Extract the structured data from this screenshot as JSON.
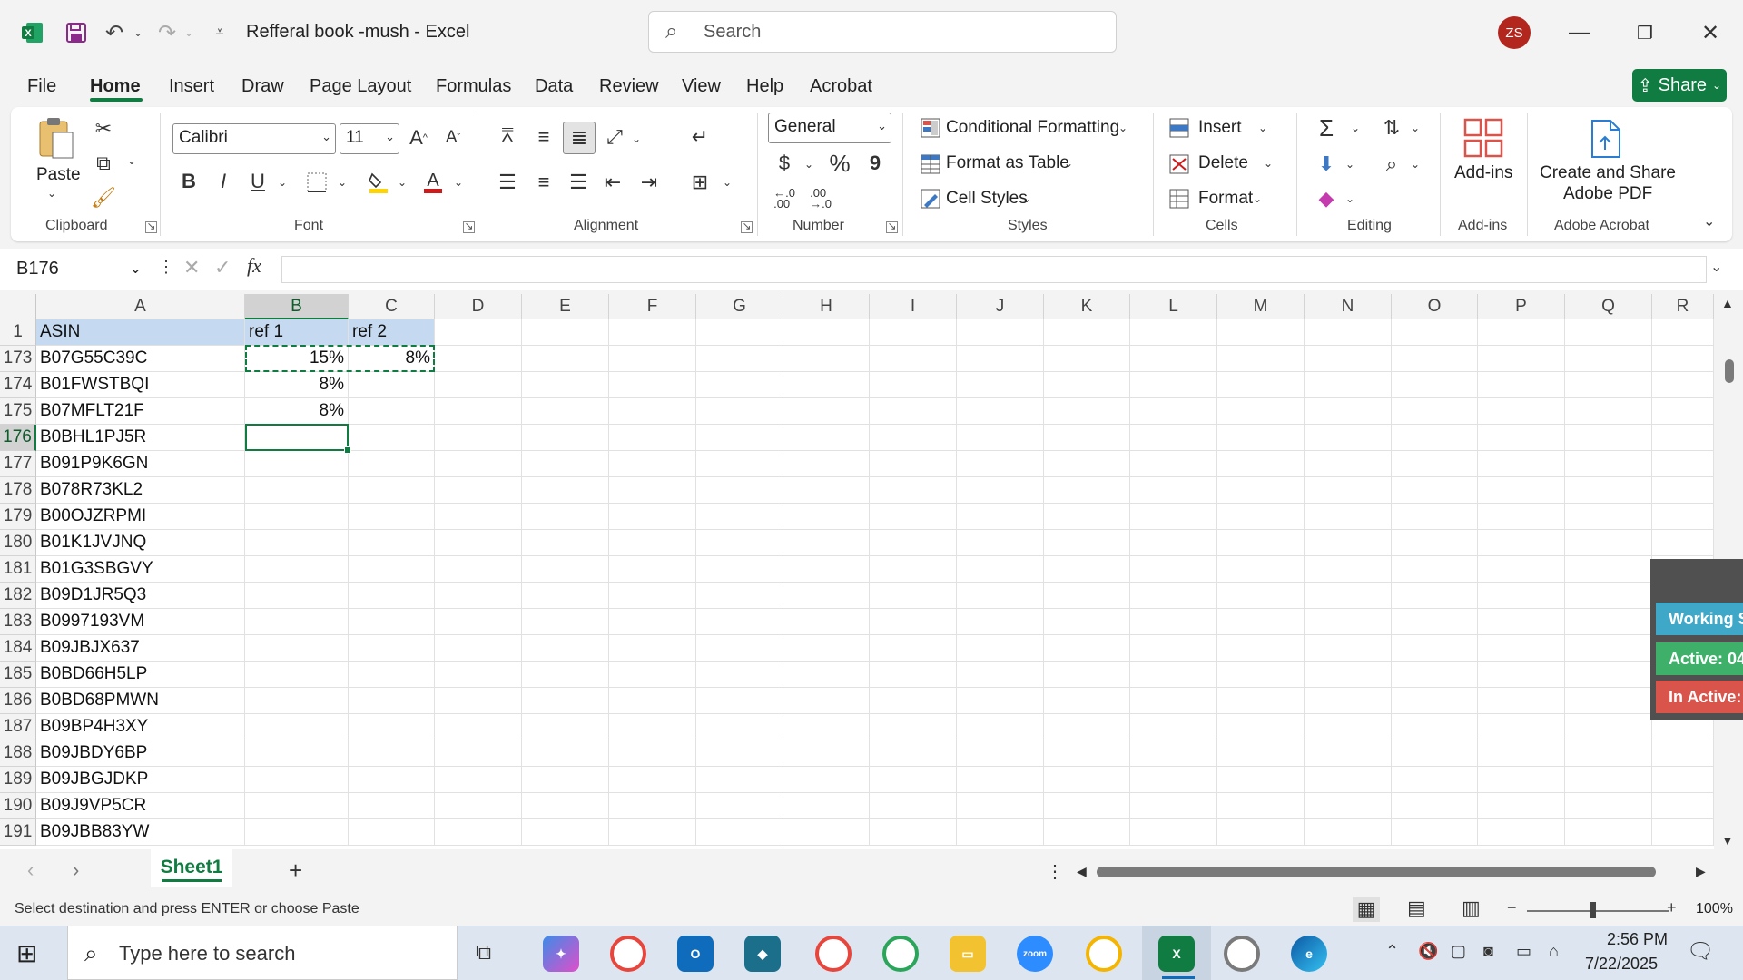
{
  "window": {
    "title": "Refferal book -mush  -  Excel",
    "search_placeholder": "Search",
    "avatar_initials": "ZS",
    "share_label": "Share"
  },
  "menu_tabs": [
    "File",
    "Home",
    "Insert",
    "Draw",
    "Page Layout",
    "Formulas",
    "Data",
    "Review",
    "View",
    "Help",
    "Acrobat"
  ],
  "ribbon": {
    "clipboard": {
      "paste": "Paste",
      "label": "Clipboard"
    },
    "font": {
      "name": "Calibri",
      "size": "11",
      "label": "Font",
      "bold": "B",
      "italic": "I",
      "underline": "U"
    },
    "alignment": {
      "label": "Alignment"
    },
    "number": {
      "format": "General",
      "currency": "$",
      "percent": "%",
      "comma": "9",
      "inc_decimal": "←.0\n.00",
      "dec_decimal": ".00\n→.0",
      "label": "Number"
    },
    "styles": {
      "conditional": "Conditional Formatting",
      "format_table": "Format as Table",
      "cell_styles": "Cell Styles",
      "label": "Styles"
    },
    "cells": {
      "insert": "Insert",
      "delete": "Delete",
      "format": "Format",
      "label": "Cells"
    },
    "editing": {
      "label": "Editing"
    },
    "addins": {
      "button": "Add-ins",
      "label": "Add-ins"
    },
    "acrobat": {
      "button_line1": "Create and Share",
      "button_line2": "Adobe PDF",
      "label": "Adobe Acrobat"
    }
  },
  "formula_bar": {
    "name_box": "B176",
    "fx": "fx",
    "value": ""
  },
  "columns": [
    "A",
    "B",
    "C",
    "D",
    "E",
    "F",
    "G",
    "H",
    "I",
    "J",
    "K",
    "L",
    "M",
    "N",
    "O",
    "P",
    "Q",
    "R"
  ],
  "header_row": {
    "row": "1",
    "a": "ASIN",
    "b": "ref 1",
    "c": "ref 2"
  },
  "rows": [
    {
      "row": "173",
      "a": "B07G55C39C",
      "b": "15%",
      "c": "8%"
    },
    {
      "row": "174",
      "a": "B01FWSTBQI",
      "b": "8%",
      "c": ""
    },
    {
      "row": "175",
      "a": "B07MFLT21F",
      "b": "8%",
      "c": ""
    },
    {
      "row": "176",
      "a": "B0BHL1PJ5R",
      "b": "",
      "c": ""
    },
    {
      "row": "177",
      "a": "B091P9K6GN",
      "b": "",
      "c": ""
    },
    {
      "row": "178",
      "a": "B078R73KL2",
      "b": "",
      "c": ""
    },
    {
      "row": "179",
      "a": "B00OJZRPMI",
      "b": "",
      "c": ""
    },
    {
      "row": "180",
      "a": "B01K1JVJNQ",
      "b": "",
      "c": ""
    },
    {
      "row": "181",
      "a": "B01G3SBGVY",
      "b": "",
      "c": ""
    },
    {
      "row": "182",
      "a": "B09D1JR5Q3",
      "b": "",
      "c": ""
    },
    {
      "row": "183",
      "a": "B0997193VM",
      "b": "",
      "c": ""
    },
    {
      "row": "184",
      "a": "B09JBJX637",
      "b": "",
      "c": ""
    },
    {
      "row": "185",
      "a": "B0BD66H5LP",
      "b": "",
      "c": ""
    },
    {
      "row": "186",
      "a": "B0BD68PMWN",
      "b": "",
      "c": ""
    },
    {
      "row": "187",
      "a": "B09BP4H3XY",
      "b": "",
      "c": ""
    },
    {
      "row": "188",
      "a": "B09JBDY6BP",
      "b": "",
      "c": ""
    },
    {
      "row": "189",
      "a": "B09JBGJDKP",
      "b": "",
      "c": ""
    },
    {
      "row": "190",
      "a": "B09J9VP5CR",
      "b": "",
      "c": ""
    },
    {
      "row": "191",
      "a": "B09JBB83YW",
      "b": "",
      "c": ""
    }
  ],
  "overlay_widget": {
    "working": "Working S",
    "active": "Active: 04",
    "inactive": "In Active:"
  },
  "sheet_tabs": {
    "active": "Sheet1",
    "add": "+"
  },
  "status_bar": {
    "message": "Select destination and press ENTER or choose Paste",
    "zoom": "100%"
  },
  "taskbar": {
    "search_placeholder": "Type here to search",
    "time": "2:56 PM",
    "date": "7/22/2025"
  },
  "colors": {
    "excel_green": "#107c41",
    "header_fill": "#c5d9f1",
    "working_btn": "#3fa7c8",
    "active_btn": "#3fb06a",
    "inactive_btn": "#d9544a"
  }
}
